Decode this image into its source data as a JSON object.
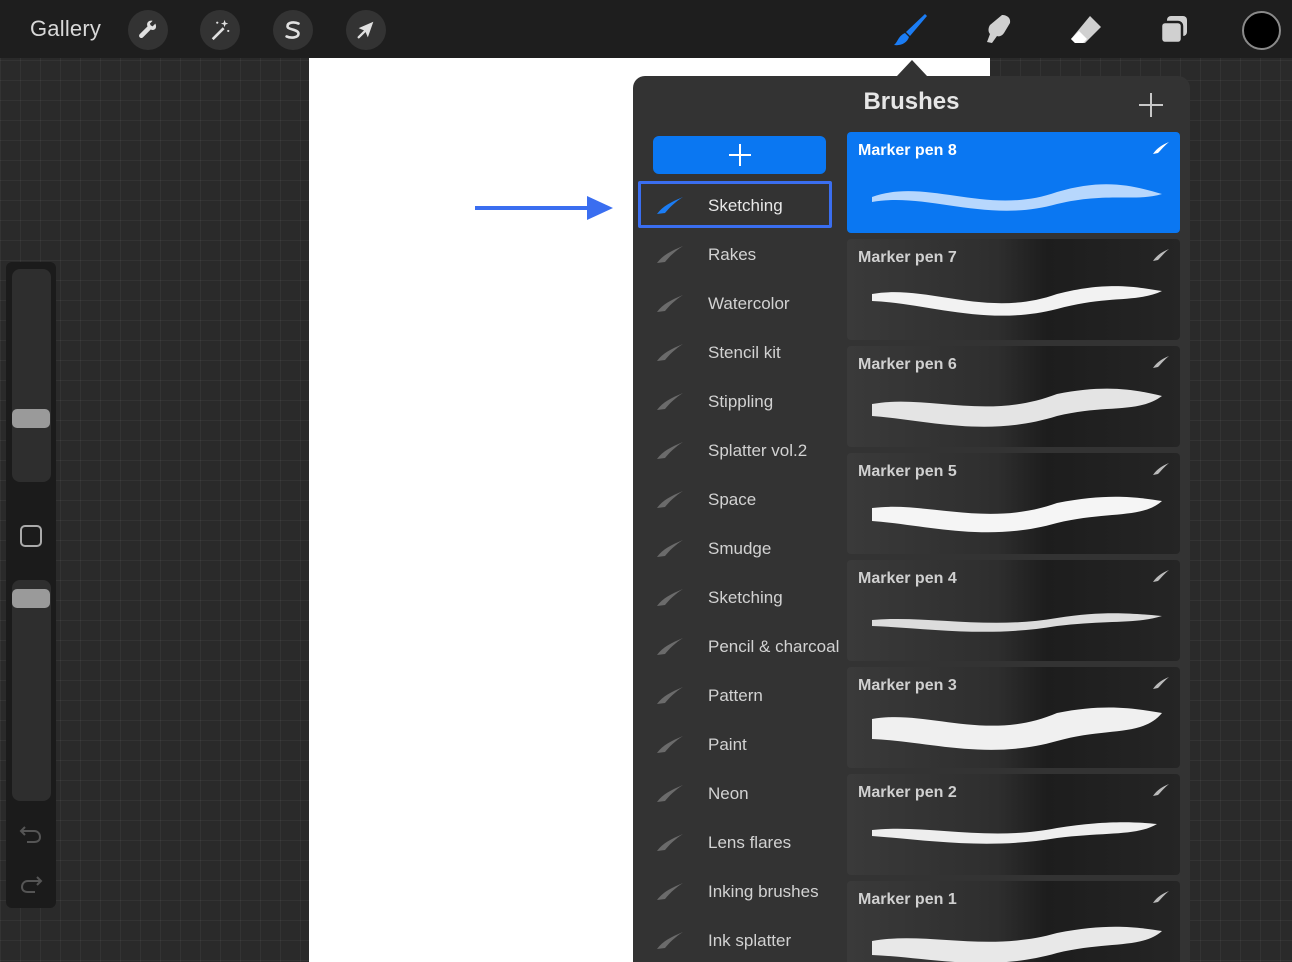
{
  "topbar": {
    "gallery_label": "Gallery",
    "tools_left": [
      "wrench-icon",
      "magic-wand-icon",
      "selection-s-icon",
      "transform-arrow-icon"
    ],
    "tools_right": [
      "brush-icon",
      "smudge-icon",
      "eraser-icon",
      "layers-icon"
    ],
    "active_tool": "brush-icon",
    "current_color": "#000000"
  },
  "colors": {
    "accent": "#0a77f2",
    "annotation": "#3a6ef0"
  },
  "panel": {
    "title": "Brushes",
    "categories": [
      {
        "label": "Sketching",
        "selected": true
      },
      {
        "label": "Rakes"
      },
      {
        "label": "Watercolor"
      },
      {
        "label": "Stencil kit"
      },
      {
        "label": "Stippling"
      },
      {
        "label": "Splatter vol.2"
      },
      {
        "label": "Space"
      },
      {
        "label": "Smudge"
      },
      {
        "label": "Sketching"
      },
      {
        "label": "Pencil & charcoal"
      },
      {
        "label": "Pattern"
      },
      {
        "label": "Paint"
      },
      {
        "label": "Neon"
      },
      {
        "label": "Lens flares"
      },
      {
        "label": "Inking brushes"
      },
      {
        "label": "Ink splatter"
      }
    ],
    "brushes": [
      {
        "name": "Marker pen 8",
        "selected": true
      },
      {
        "name": "Marker pen 7"
      },
      {
        "name": "Marker pen 6"
      },
      {
        "name": "Marker pen 5"
      },
      {
        "name": "Marker pen 4"
      },
      {
        "name": "Marker pen 3"
      },
      {
        "name": "Marker pen 2"
      },
      {
        "name": "Marker pen 1"
      }
    ]
  }
}
